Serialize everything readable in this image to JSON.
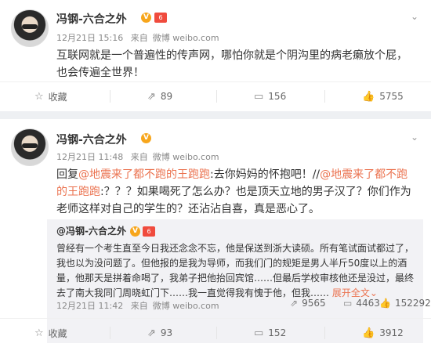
{
  "post1": {
    "author": "冯钢-六合之外",
    "v_badge": "V",
    "crown_badge": "6",
    "date": "12月21日 15:16",
    "source_prefix": "来自",
    "source": "微博 weibo.com",
    "content": "互联网就是一个普遍性的传声网，哪怕你就是个阴沟里的病老癞放个屁，也会传遍全世界！",
    "actions": {
      "favorite": "收藏",
      "repost": "89",
      "comment": "156",
      "like": "5755"
    }
  },
  "post2": {
    "author": "冯钢-六合之外",
    "v_badge": "V",
    "crown_badge": "6",
    "date": "12月21日 11:48",
    "source_prefix": "来自",
    "source": "微博 weibo.com",
    "content_prefix": "回复",
    "mention1": "@地震来了都不跑的王跑跑",
    "content_mid": ":去你妈妈的怀抱吧！//",
    "mention2": "@地震来了都不跑的王跑跑",
    "content_rest": ":？？？如果喝死了怎么办？也是顶天立地的男子汉了？你们作为老师这样对自己的学生的？还沾沾自喜，真是恶心了。",
    "quote": {
      "author": "@冯钢-六合之外",
      "v_badge": "V",
      "crown_badge": "6",
      "text": "曾经有一个考生直至今日我还念念不忘，他是保送到浙大读硕。所有笔试面试都过了，我也以为没问题了。但他报的是我为导师，而我们门的规矩是男人半斤50度以上的酒量，他那天是拼着命喝了，我弟子把他抬回宾馆……但最后学校审核他还是没过，最终去了南大我同门周晓虹门下……我一直觉得我有愧于他，但我……",
      "more": "展开全文",
      "more_icon": "chevron-down-icon",
      "date": "12月21日 11:42",
      "source_prefix": "来自",
      "source": "微博 weibo.com",
      "repost": "9565",
      "comment": "4463",
      "like": "152292"
    },
    "actions": {
      "favorite": "收藏",
      "repost": "93",
      "comment": "152",
      "like": "3912"
    }
  },
  "colors": {
    "link": "#eb7350",
    "badge_v": "#f7a61c",
    "badge_crown": "#f04b3d"
  }
}
